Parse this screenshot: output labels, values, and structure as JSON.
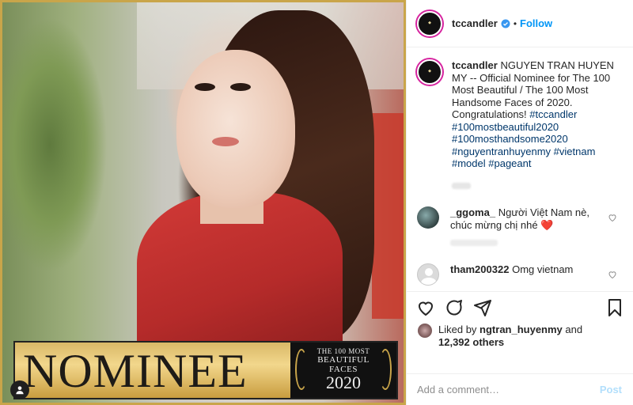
{
  "post": {
    "nominee_word": "NOMINEE",
    "award_line1": "THE 100 MOST",
    "award_line2": "BEAUTIFUL",
    "award_line3": "FACES",
    "award_year": "2020",
    "border_color": "#c9a54a"
  },
  "header": {
    "username": "tccandler",
    "separator": "•",
    "follow_label": "Follow"
  },
  "caption": {
    "username": "tccandler",
    "text": "NGUYEN TRAN HUYEN MY -- Official Nominee for The 100 Most Beautiful / The 100 Most Handsome Faces of 2020. Congratulations!",
    "hashtags": [
      "#tccandler",
      "#100mostbeautiful2020",
      "#100mosthandsome2020",
      "#nguyentranhuyenmy",
      "#vietnam",
      "#model",
      "#pageant"
    ]
  },
  "comments": [
    {
      "username": "_ggoma_",
      "text": "Người Việt Nam nè, chúc mừng chị nhé",
      "emoji": "❤️"
    },
    {
      "username": "tham200322",
      "text": "Omg vietnam"
    }
  ],
  "likes": {
    "prefix": "Liked by",
    "user": "ngtran_huyenmy",
    "conj": "and",
    "count": "12,392 others"
  },
  "add_comment": {
    "placeholder": "Add a comment…",
    "post_label": "Post"
  },
  "icons": {
    "like": "heart-icon",
    "comment": "comment-icon",
    "share": "share-icon",
    "save": "bookmark-icon",
    "verified": "verified-badge-icon",
    "user_tag": "user-tag-icon"
  },
  "colors": {
    "accent": "#0095f6",
    "hashtag": "#00376b",
    "like_heart": "#ed4956"
  }
}
